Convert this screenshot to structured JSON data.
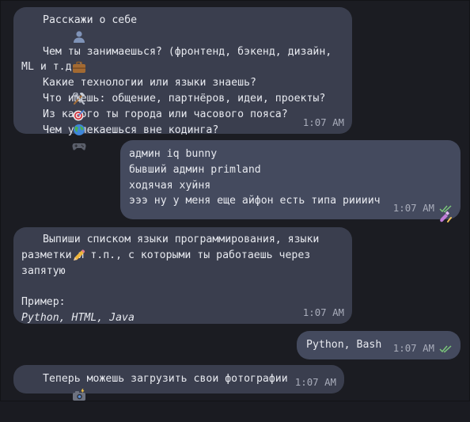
{
  "chat": {
    "messages": [
      {
        "id": "m1",
        "direction": "incoming",
        "lines": [
          {
            "icon": "bust-silhouette-icon",
            "text": "Расскажи о себе"
          },
          {
            "icon": null,
            "text": ""
          },
          {
            "icon": "briefcase-icon",
            "text": "Чем ты занимаешься? (фронтенд, бэкенд, дизайн,"
          },
          {
            "icon": null,
            "text": "ML и т.д.)"
          },
          {
            "icon": "hammer-and-wrench-icon",
            "text": "Какие технологии или языки знаешь?"
          },
          {
            "icon": "bullseye-icon",
            "text": "Что ищешь: общение, партнёров, идеи, проекты?"
          },
          {
            "icon": "globe-icon",
            "text": "Из какого ты города или часового пояса?"
          },
          {
            "icon": "gamepad-icon",
            "text": "Чем увлекаешься вне кодинга?"
          }
        ],
        "time": "1:07 AM"
      },
      {
        "id": "m2",
        "direction": "outgoing",
        "lines": [
          {
            "text": "админ iq bunny"
          },
          {
            "text": "бывший админ primland"
          },
          {
            "text": "ходячая хуйня"
          },
          {
            "text": "эээ ну у меня еще айфон есть типа риииич"
          }
        ],
        "trailing_icon": "nail-polish-icon",
        "time": "1:07 AM",
        "status": "read"
      },
      {
        "id": "m3",
        "direction": "incoming",
        "lines": [
          {
            "icon": "pencil-icon",
            "text": "Выпиши списком языки программирования, языки"
          },
          {
            "icon": null,
            "text": "разметки и т.п., с которыми ты работаешь через"
          },
          {
            "icon": null,
            "text": "запятую"
          },
          {
            "icon": null,
            "text": ""
          },
          {
            "icon": null,
            "text": "Пример:"
          },
          {
            "icon": null,
            "text": "Python, HTML, Java",
            "italic": true
          }
        ],
        "time": "1:07 AM"
      },
      {
        "id": "m4",
        "direction": "outgoing",
        "lines": [
          {
            "text": "Python, Bash"
          }
        ],
        "time": "1:07 AM",
        "status": "read"
      },
      {
        "id": "m5",
        "direction": "incoming",
        "lines": [
          {
            "icon": "camera-with-flash-icon",
            "text": "Теперь можешь загрузить свои фотографии"
          }
        ],
        "time": "1:07 AM"
      }
    ],
    "colors": {
      "background": "#1b1c22",
      "incoming_bubble": "#3a3e4e",
      "outgoing_bubble": "#444a5e",
      "read_checks": "#7bc67a"
    }
  }
}
